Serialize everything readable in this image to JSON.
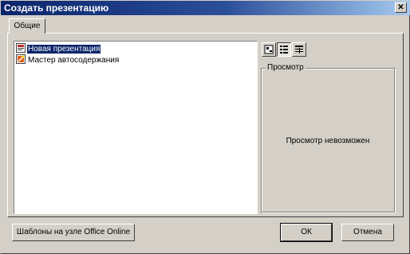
{
  "window": {
    "title": "Создать презентацию",
    "close_glyph": "✕"
  },
  "tabs": [
    {
      "label": "Общие"
    }
  ],
  "templates": [
    {
      "label": "Новая презентация",
      "icon": "new-presentation-icon",
      "selected": true
    },
    {
      "label": "Мастер автосодержания",
      "icon": "autocontent-wizard-icon",
      "selected": false
    }
  ],
  "view_buttons": [
    {
      "icon": "large-icons-icon",
      "pressed": false
    },
    {
      "icon": "list-view-icon",
      "pressed": true
    },
    {
      "icon": "details-view-icon",
      "pressed": false
    }
  ],
  "preview": {
    "title": "Просмотр",
    "message": "Просмотр невозможен"
  },
  "buttons": {
    "online_templates": "Шаблоны на узле Office Online",
    "ok": "ОК",
    "cancel": "Отмена"
  },
  "colors": {
    "title_start": "#0a246a",
    "title_end": "#a6caf0",
    "selection": "#0a246a",
    "face": "#d4d0c8"
  }
}
